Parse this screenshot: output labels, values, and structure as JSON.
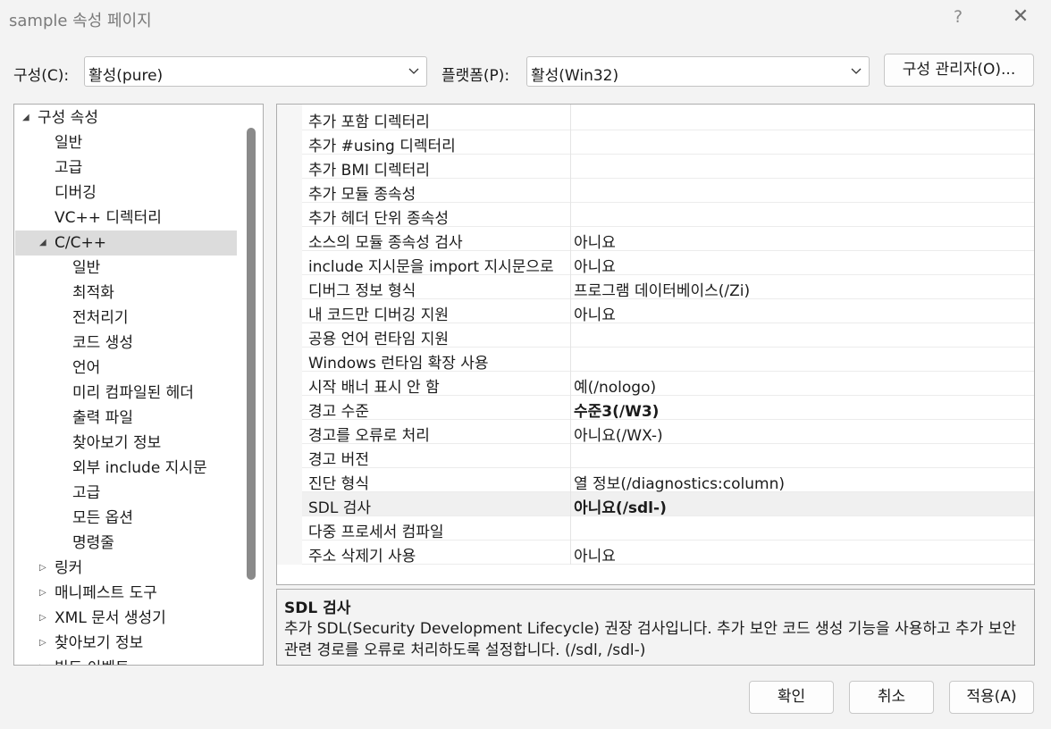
{
  "window": {
    "title": "sample 속성 페이지",
    "help_glyph": "?",
    "close_glyph": "✕"
  },
  "config": {
    "config_label": "구성(C):",
    "config_value": "활성(pure)",
    "platform_label": "플랫폼(P):",
    "platform_value": "활성(Win32)",
    "manager_button": "구성 관리자(O)..."
  },
  "tree": {
    "items": [
      {
        "label": "구성 속성",
        "expanded": true
      },
      {
        "label": "일반"
      },
      {
        "label": "고급"
      },
      {
        "label": "디버깅"
      },
      {
        "label": "VC++ 디렉터리"
      },
      {
        "label": "C/C++",
        "expanded": true,
        "selected": true
      },
      {
        "label": "일반"
      },
      {
        "label": "최적화"
      },
      {
        "label": "전처리기"
      },
      {
        "label": "코드 생성"
      },
      {
        "label": "언어"
      },
      {
        "label": "미리 컴파일된 헤더"
      },
      {
        "label": "출력 파일"
      },
      {
        "label": "찾아보기 정보"
      },
      {
        "label": "외부 include 지시문"
      },
      {
        "label": "고급"
      },
      {
        "label": "모든 옵션"
      },
      {
        "label": "명령줄"
      },
      {
        "label": "링커",
        "expanded": false
      },
      {
        "label": "매니페스트 도구",
        "expanded": false
      },
      {
        "label": "XML 문서 생성기",
        "expanded": false
      },
      {
        "label": "찾아보기 정보",
        "expanded": false
      },
      {
        "label": "빌드 이벤트",
        "expanded": false
      }
    ]
  },
  "grid": {
    "rows": [
      {
        "name": "추가 포함 디렉터리",
        "value": ""
      },
      {
        "name": "추가 #using 디렉터리",
        "value": ""
      },
      {
        "name": "추가 BMI 디렉터리",
        "value": ""
      },
      {
        "name": "추가 모듈 종속성",
        "value": ""
      },
      {
        "name": "추가 헤더 단위 종속성",
        "value": ""
      },
      {
        "name": "소스의 모듈 종속성 검사",
        "value": "아니요"
      },
      {
        "name": "include 지시문을 import 지시문으로",
        "value": "아니요"
      },
      {
        "name": "디버그 정보 형식",
        "value": "프로그램 데이터베이스(/Zi)"
      },
      {
        "name": "내 코드만 디버깅 지원",
        "value": "아니요"
      },
      {
        "name": "공용 언어 런타임 지원",
        "value": ""
      },
      {
        "name": "Windows 런타임 확장 사용",
        "value": ""
      },
      {
        "name": "시작 배너 표시 안 함",
        "value": "예(/nologo)"
      },
      {
        "name": "경고 수준",
        "value": "수준3(/W3)",
        "bold": true
      },
      {
        "name": "경고를 오류로 처리",
        "value": "아니요(/WX-)"
      },
      {
        "name": "경고 버전",
        "value": ""
      },
      {
        "name": "진단 형식",
        "value": "열 정보(/diagnostics:column)"
      },
      {
        "name": "SDL 검사",
        "value": "아니요(/sdl-)",
        "bold": true,
        "selected": true
      },
      {
        "name": "다중 프로세서 컴파일",
        "value": ""
      },
      {
        "name": "주소 삭제기 사용",
        "value": "아니요"
      }
    ]
  },
  "description": {
    "title": "SDL 검사",
    "text": "추가 SDL(Security Development Lifecycle) 권장 검사입니다. 추가 보안 코드 생성 기능을 사용하고 추가 보안 관련 경로를 오류로 처리하도록 설정합니다. (/sdl, /sdl-)"
  },
  "buttons": {
    "ok": "확인",
    "cancel": "취소",
    "apply": "적용(A)"
  }
}
